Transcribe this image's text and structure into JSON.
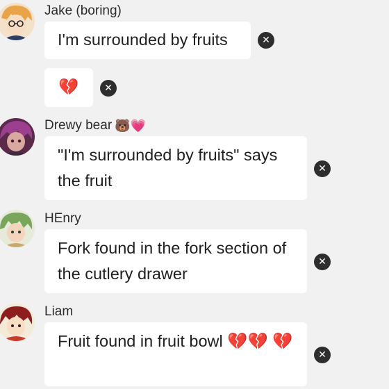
{
  "messages": [
    {
      "author": "Jake (boring)",
      "text": "I'm surrounded by fruits",
      "extra_bubble": "💔"
    },
    {
      "author": "Drewy bear",
      "author_emojis": "🐻💗",
      "text": "\"I'm surrounded by fruits\" says the fruit"
    },
    {
      "author": "HEnry",
      "text": "Fork found in the fork section of the cutlery drawer"
    },
    {
      "author": "Liam",
      "text": "Fruit found in fruit bowl 💔💔 💔"
    }
  ],
  "icons": {
    "delete": "close-icon",
    "avatar": "avatar"
  },
  "colors": {
    "background": "#f1f1f1",
    "bubble": "#ffffff",
    "delete_button": "#2e2e2e",
    "text": "#1f1f1f"
  }
}
